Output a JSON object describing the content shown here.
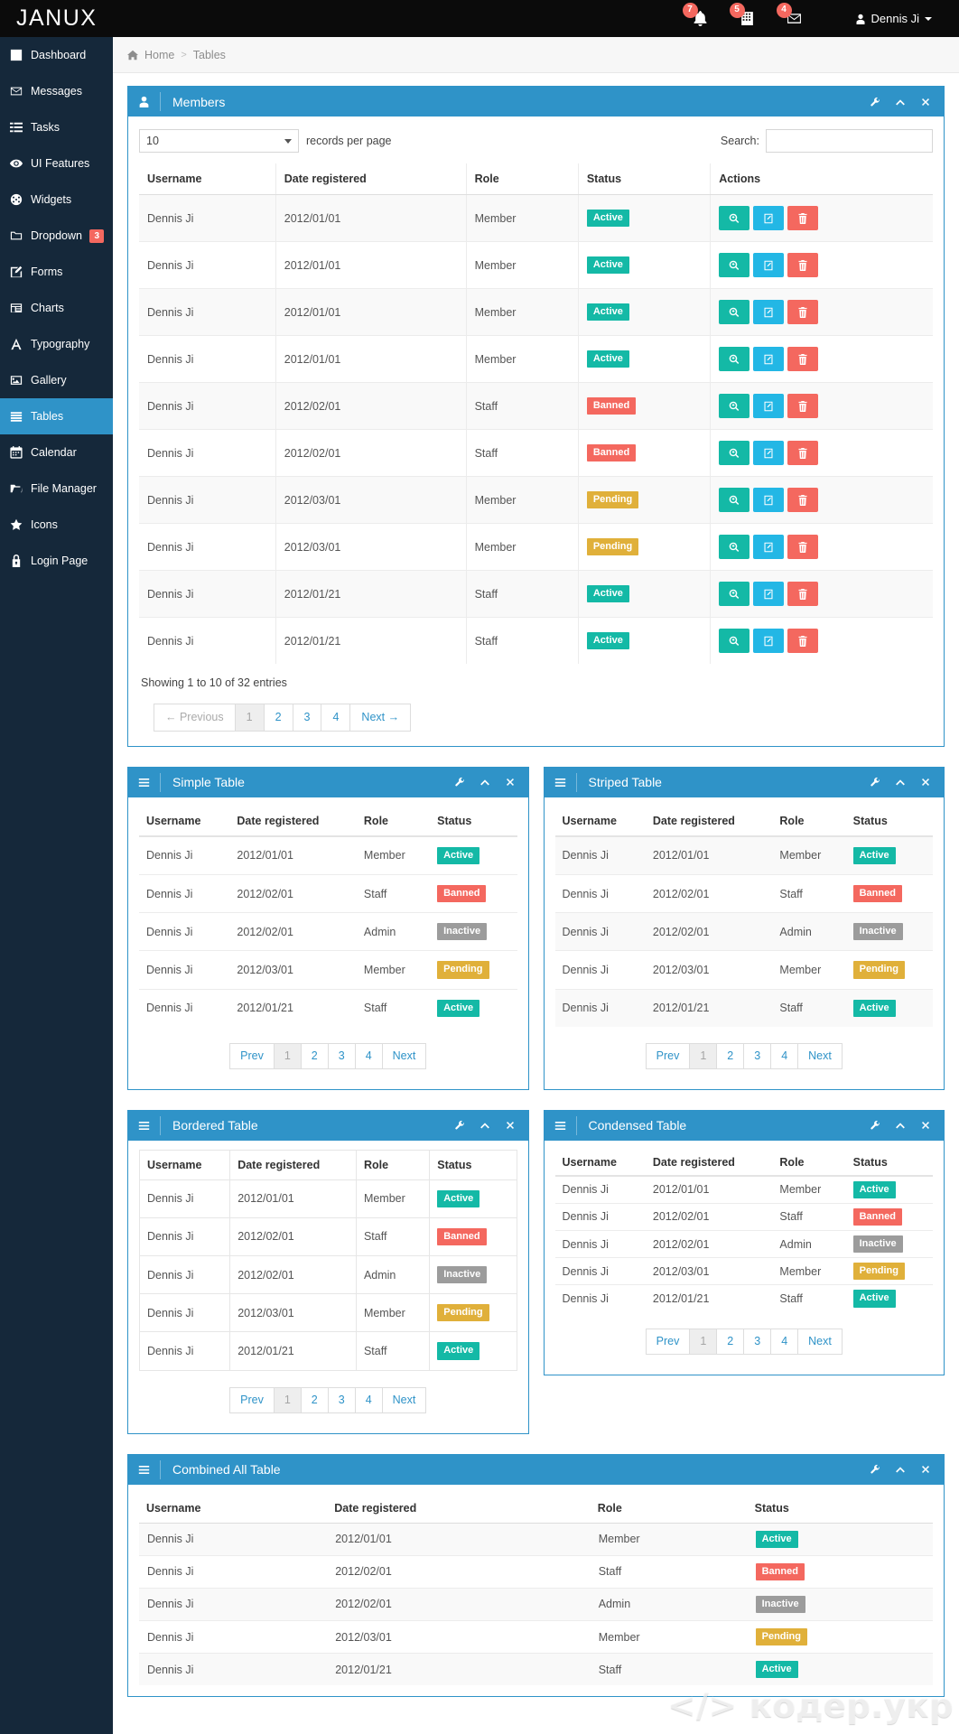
{
  "brand": "JANUX",
  "topbar": {
    "notifications": [
      {
        "icon": "bell-icon",
        "count": "7"
      },
      {
        "icon": "chart-icon",
        "count": "5"
      },
      {
        "icon": "envelope-icon",
        "count": "4"
      }
    ],
    "user_name": "Dennis Ji"
  },
  "sidebar": {
    "items": [
      {
        "label": "Dashboard",
        "icon": "dashboard-icon",
        "active": false,
        "badge": null
      },
      {
        "label": "Messages",
        "icon": "envelope-icon",
        "active": false,
        "badge": null
      },
      {
        "label": "Tasks",
        "icon": "tasks-icon",
        "active": false,
        "badge": null
      },
      {
        "label": "UI Features",
        "icon": "eye-icon",
        "active": false,
        "badge": null
      },
      {
        "label": "Widgets",
        "icon": "widgets-icon",
        "active": false,
        "badge": null
      },
      {
        "label": "Dropdown",
        "icon": "folder-icon",
        "active": false,
        "badge": "3"
      },
      {
        "label": "Forms",
        "icon": "pencil-square-icon",
        "active": false,
        "badge": null
      },
      {
        "label": "Charts",
        "icon": "charts-icon",
        "active": false,
        "badge": null
      },
      {
        "label": "Typography",
        "icon": "typography-icon",
        "active": false,
        "badge": null
      },
      {
        "label": "Gallery",
        "icon": "image-icon",
        "active": false,
        "badge": null
      },
      {
        "label": "Tables",
        "icon": "table-icon",
        "active": true,
        "badge": null
      },
      {
        "label": "Calendar",
        "icon": "calendar-icon",
        "active": false,
        "badge": null
      },
      {
        "label": "File Manager",
        "icon": "folder-open-icon",
        "active": false,
        "badge": null
      },
      {
        "label": "Icons",
        "icon": "star-icon",
        "active": false,
        "badge": null
      },
      {
        "label": "Login Page",
        "icon": "lock-icon",
        "active": false,
        "badge": null
      }
    ]
  },
  "breadcrumb": {
    "home": "Home",
    "separator": ">",
    "current": "Tables"
  },
  "panel_tools": {
    "wrench": "wrench-icon",
    "collapse": "chevron-up-icon",
    "close": "close-icon"
  },
  "members_panel": {
    "title": "Members",
    "icon": "user-icon",
    "length_value": "10",
    "length_label": "records per page",
    "search_label": "Search:",
    "search_value": "",
    "search_placeholder": "",
    "columns": [
      "Username",
      "Date registered",
      "Role",
      "Status",
      "Actions"
    ],
    "rows": [
      {
        "username": "Dennis Ji",
        "date": "2012/01/01",
        "role": "Member",
        "status": "Active",
        "status_class": "active"
      },
      {
        "username": "Dennis Ji",
        "date": "2012/01/01",
        "role": "Member",
        "status": "Active",
        "status_class": "active"
      },
      {
        "username": "Dennis Ji",
        "date": "2012/01/01",
        "role": "Member",
        "status": "Active",
        "status_class": "active"
      },
      {
        "username": "Dennis Ji",
        "date": "2012/01/01",
        "role": "Member",
        "status": "Active",
        "status_class": "active"
      },
      {
        "username": "Dennis Ji",
        "date": "2012/02/01",
        "role": "Staff",
        "status": "Banned",
        "status_class": "banned"
      },
      {
        "username": "Dennis Ji",
        "date": "2012/02/01",
        "role": "Staff",
        "status": "Banned",
        "status_class": "banned"
      },
      {
        "username": "Dennis Ji",
        "date": "2012/03/01",
        "role": "Member",
        "status": "Pending",
        "status_class": "pending"
      },
      {
        "username": "Dennis Ji",
        "date": "2012/03/01",
        "role": "Member",
        "status": "Pending",
        "status_class": "pending"
      },
      {
        "username": "Dennis Ji",
        "date": "2012/01/21",
        "role": "Staff",
        "status": "Active",
        "status_class": "active"
      },
      {
        "username": "Dennis Ji",
        "date": "2012/01/21",
        "role": "Staff",
        "status": "Active",
        "status_class": "active"
      }
    ],
    "actions": [
      {
        "name": "view-button",
        "icon": "magnifier-icon",
        "class": "act-view"
      },
      {
        "name": "edit-button",
        "icon": "edit-icon",
        "class": "act-edit"
      },
      {
        "name": "delete-button",
        "icon": "trash-icon",
        "class": "act-delete"
      }
    ],
    "info": "Showing 1 to 10 of 32 entries",
    "pagination": {
      "prev": "← Previous",
      "pages": [
        "1",
        "2",
        "3",
        "4"
      ],
      "next": "Next →",
      "active_page": "1"
    }
  },
  "small_pagination": {
    "prev": "Prev",
    "pages": [
      "1",
      "2",
      "3",
      "4"
    ],
    "next": "Next",
    "active_page": "1"
  },
  "small_columns": [
    "Username",
    "Date registered",
    "Role",
    "Status"
  ],
  "small_rows": [
    {
      "username": "Dennis Ji",
      "date": "2012/01/01",
      "role": "Member",
      "status": "Active",
      "status_class": "active"
    },
    {
      "username": "Dennis Ji",
      "date": "2012/02/01",
      "role": "Staff",
      "status": "Banned",
      "status_class": "banned"
    },
    {
      "username": "Dennis Ji",
      "date": "2012/02/01",
      "role": "Admin",
      "status": "Inactive",
      "status_class": "inactive"
    },
    {
      "username": "Dennis Ji",
      "date": "2012/03/01",
      "role": "Member",
      "status": "Pending",
      "status_class": "pending"
    },
    {
      "username": "Dennis Ji",
      "date": "2012/01/21",
      "role": "Staff",
      "status": "Active",
      "status_class": "active"
    }
  ],
  "panels": {
    "simple": {
      "title": "Simple Table",
      "icon": "hamburger-icon"
    },
    "striped": {
      "title": "Striped Table",
      "icon": "hamburger-icon"
    },
    "bordered": {
      "title": "Bordered Table",
      "icon": "hamburger-icon"
    },
    "condensed": {
      "title": "Condensed Table",
      "icon": "hamburger-icon"
    },
    "combined": {
      "title": "Combined All Table",
      "icon": "hamburger-icon"
    }
  },
  "watermark": "</> кодер.укр"
}
